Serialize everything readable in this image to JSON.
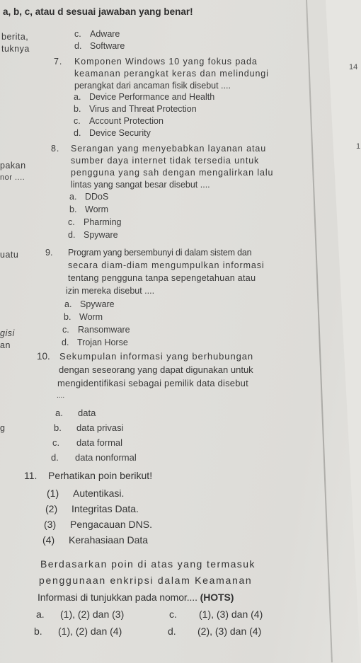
{
  "header": "a, b, c, atau d sesuai jawaban yang benar!",
  "left_fragments": [
    "berita,",
    "tuknya",
    "pakan",
    "nor ....",
    "uatu",
    "gisi",
    "an",
    "g"
  ],
  "q6_tail": [
    {
      "letter": "c.",
      "text": "Adware"
    },
    {
      "letter": "d.",
      "text": "Software"
    }
  ],
  "questions": [
    {
      "number": "7.",
      "lines": [
        "Komponen Windows 10 yang fokus pada",
        "keamanan perangkat keras dan melindungi",
        "perangkat dari ancaman fisik disebut ...."
      ],
      "options": [
        {
          "letter": "a.",
          "text": "Device Performance and Health"
        },
        {
          "letter": "b.",
          "text": "Virus and Threat Protection"
        },
        {
          "letter": "c.",
          "text": "Account Protection"
        },
        {
          "letter": "d.",
          "text": "Device Security"
        }
      ]
    },
    {
      "number": "8.",
      "lines": [
        "Serangan yang menyebabkan layanan atau",
        "sumber daya internet tidak tersedia untuk",
        "pengguna yang sah dengan mengalirkan lalu",
        "lintas yang sangat besar disebut ...."
      ],
      "options": [
        {
          "letter": "a.",
          "text": "DDoS"
        },
        {
          "letter": "b.",
          "text": "Worm"
        },
        {
          "letter": "c.",
          "text": "Pharming"
        },
        {
          "letter": "d.",
          "text": "Spyware"
        }
      ]
    },
    {
      "number": "9.",
      "lines": [
        "Program yang bersembunyi di dalam sistem dan",
        "secara diam-diam mengumpulkan informasi",
        "tentang pengguna tanpa sepengetahuan atau",
        "izin mereka disebut ...."
      ],
      "options": [
        {
          "letter": "a.",
          "text": "Spyware"
        },
        {
          "letter": "b.",
          "text": "Worm"
        },
        {
          "letter": "c.",
          "text": "Ransomware"
        },
        {
          "letter": "d.",
          "text": "Trojan Horse"
        }
      ]
    },
    {
      "number": "10.",
      "lines": [
        "Sekumpulan informasi yang berhubungan",
        "dengan seseorang yang dapat digunakan untuk",
        "mengidentifikasi sebagai pemilik data disebut",
        "...."
      ],
      "options": [
        {
          "letter": "a.",
          "text": "data"
        },
        {
          "letter": "b.",
          "text": "data privasi"
        },
        {
          "letter": "c.",
          "text": "data formal"
        },
        {
          "letter": "d.",
          "text": "data nonformal"
        }
      ]
    },
    {
      "number": "11.",
      "intro": "Perhatikan poin berikut!",
      "points": [
        {
          "num": "(1)",
          "text": "Autentikasi."
        },
        {
          "num": "(2)",
          "text": "Integritas Data."
        },
        {
          "num": "(3)",
          "text": "Pengacauan DNS."
        },
        {
          "num": "(4)",
          "text": "Kerahasiaan Data"
        }
      ],
      "lines": [
        "Berdasarkan poin di atas yang termasuk",
        "penggunaan enkripsi dalam Keamanan",
        "Informasi di tunjukkan pada nomor...."
      ],
      "tag": "(HOTS)",
      "options": [
        {
          "letter": "a.",
          "text": "(1), (2) dan (3)"
        },
        {
          "letter": "b.",
          "text": "(1), (2) dan (4)"
        },
        {
          "letter": "c.",
          "text": "(1), (3) dan (4)"
        },
        {
          "letter": "d.",
          "text": "(2), (3) dan (4)"
        }
      ]
    }
  ],
  "right_page_numbers": [
    "14",
    "1"
  ]
}
